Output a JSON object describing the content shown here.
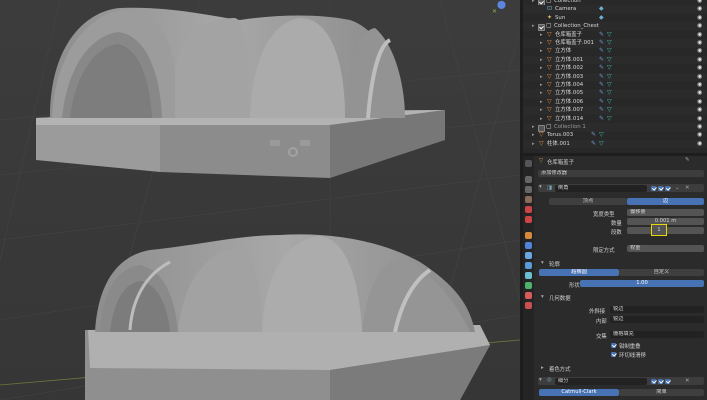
{
  "outliner": {
    "rows": [
      {
        "label": "Collection",
        "indent": 1,
        "type": "collection",
        "checked": true,
        "extras": []
      },
      {
        "label": "Camera",
        "indent": 2,
        "type": "camera",
        "checked": false,
        "extras": [
          "camera-data"
        ]
      },
      {
        "label": "Sun",
        "indent": 2,
        "type": "light",
        "checked": false,
        "extras": [
          "light-data"
        ]
      },
      {
        "label": "Collection_Chest",
        "indent": 1,
        "type": "collection",
        "checked": true,
        "extras": []
      },
      {
        "label": "仓库箱盖子",
        "indent": 2,
        "type": "mesh",
        "checked": false,
        "extras": [
          "wrench",
          "mesh-data"
        ]
      },
      {
        "label": "仓库箱盖子.001",
        "indent": 2,
        "type": "mesh",
        "checked": false,
        "extras": [
          "wrench",
          "mesh-data"
        ]
      },
      {
        "label": "立方体",
        "indent": 2,
        "type": "mesh",
        "checked": false,
        "extras": [
          "wrench",
          "mesh-data"
        ]
      },
      {
        "label": "立方体.001",
        "indent": 2,
        "type": "mesh",
        "checked": false,
        "extras": [
          "wrench",
          "mesh-data"
        ]
      },
      {
        "label": "立方体.002",
        "indent": 2,
        "type": "mesh",
        "checked": false,
        "extras": [
          "wrench",
          "mesh-data"
        ]
      },
      {
        "label": "立方体.003",
        "indent": 2,
        "type": "mesh",
        "checked": false,
        "extras": [
          "wrench",
          "mesh-data"
        ]
      },
      {
        "label": "立方体.004",
        "indent": 2,
        "type": "mesh",
        "checked": false,
        "extras": [
          "wrench",
          "mesh-data"
        ]
      },
      {
        "label": "立方体.005",
        "indent": 2,
        "type": "mesh",
        "checked": false,
        "extras": [
          "wrench",
          "mesh-data"
        ]
      },
      {
        "label": "立方体.006",
        "indent": 2,
        "type": "mesh",
        "checked": false,
        "extras": [
          "wrench",
          "mesh-data"
        ]
      },
      {
        "label": "立方体.007",
        "indent": 2,
        "type": "mesh",
        "checked": false,
        "extras": [
          "wrench",
          "mesh-data"
        ]
      },
      {
        "label": "立方体.014",
        "indent": 2,
        "type": "mesh",
        "checked": false,
        "extras": [
          "wrench",
          "mesh-data"
        ]
      },
      {
        "label": "Collection 1",
        "indent": 1,
        "type": "collection",
        "checked": false,
        "extras": []
      },
      {
        "label": "Torus.003",
        "indent": 1,
        "type": "mesh",
        "checked": false,
        "extras": [
          "wrench",
          "mesh-data"
        ]
      },
      {
        "label": "柱体.001",
        "indent": 1,
        "type": "mesh",
        "checked": false,
        "extras": [
          "wrench",
          "mesh-data"
        ]
      }
    ]
  },
  "properties": {
    "object_name": "仓库箱盖子",
    "add_modifier": "添加修改器",
    "bevel": {
      "name": "倒角",
      "tab_vertices": "顶点",
      "tab_edges": "边",
      "width_type_label": "宽度类型",
      "width_type_value": "偏移量",
      "amount_label": "数量",
      "amount_value": "0.001 m",
      "segments_label": "段数",
      "segments_value": "1",
      "limit_label": "限定方式",
      "limit_value": "权重"
    },
    "profile": {
      "section": "轮廓",
      "superellipse": "超椭圆",
      "custom": "自定义",
      "shape_label": "形状",
      "shape_value": "1.00"
    },
    "geometry": {
      "section": "几何数据",
      "outer_label": "外斜接",
      "outer_value": "锐边",
      "inner_label": "内部",
      "inner_value": "锐边",
      "intersection_label": "交集",
      "intersection_value": "栅格填充",
      "clamp": "钳制重叠",
      "loop_slide": "环切线滑移"
    },
    "shading": {
      "section": "着色方式"
    },
    "subsurf": {
      "name": "细分",
      "catmull": "Catmull-Clark",
      "simple": "简单"
    }
  },
  "colors": {
    "accent": "#4772b3",
    "highlight": "#e8d800",
    "viewport_bg": "#3a3a3a",
    "panel_bg": "#2b2b2b"
  }
}
